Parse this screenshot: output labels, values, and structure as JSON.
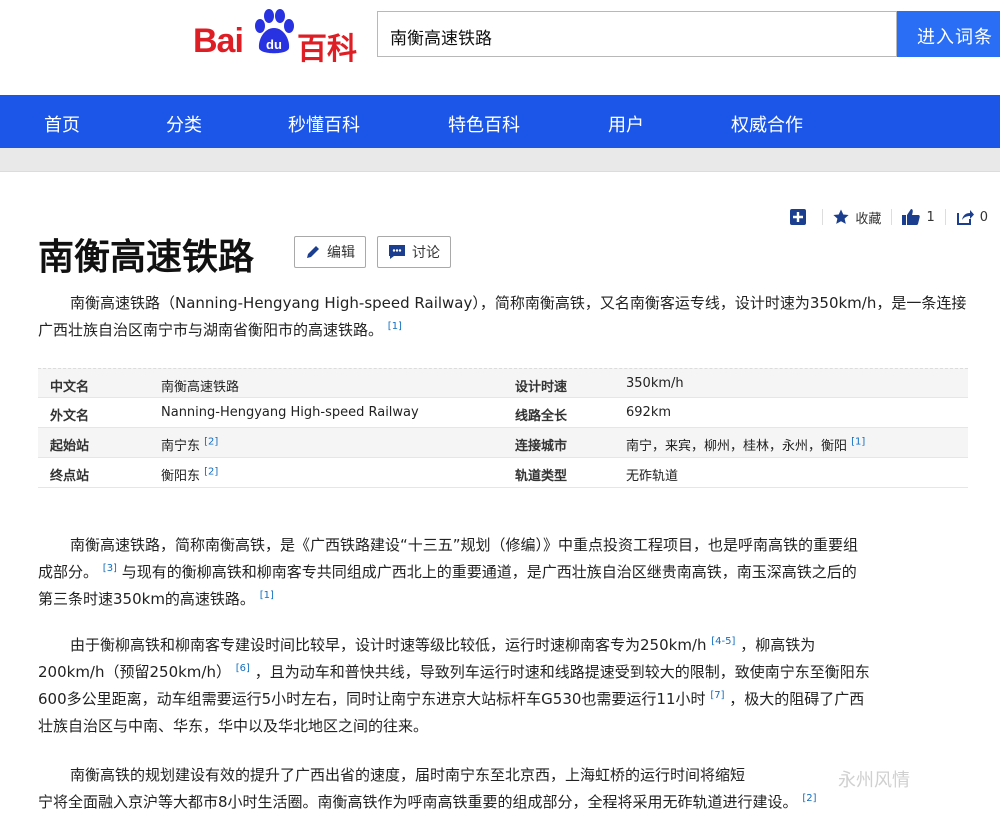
{
  "header": {
    "logo_bai": "Bai",
    "logo_du": "du",
    "logo_bk": "百科",
    "search_value": "南衡高速铁路",
    "search_button": "进入词条"
  },
  "nav": [
    "首页",
    "分类",
    "秒懂百科",
    "特色百科",
    "用户",
    "权威合作"
  ],
  "toolbar": {
    "collect_label": "收藏",
    "like_count": "1",
    "share_count": "0"
  },
  "page": {
    "title": "南衡高速铁路",
    "edit_label": "编辑",
    "discuss_label": "讨论"
  },
  "intro": {
    "text": "南衡高速铁路（Nanning-Hengyang High-speed Railway），简称南衡高铁，又名南衡客运专线，设计时速为350km/h，是一条连接广西壮族自治区南宁市与湖南省衡阳市的高速铁路。",
    "ref": "[1]"
  },
  "infobox": [
    {
      "l1": "中文名",
      "v1": "南衡高速铁路",
      "r1": "",
      "l2": "设计时速",
      "v2": "350km/h",
      "r2": ""
    },
    {
      "l1": "外文名",
      "v1": "Nanning-Hengyang High-speed Railway",
      "r1": "",
      "l2": "线路全长",
      "v2": "692km",
      "r2": ""
    },
    {
      "l1": "起始站",
      "v1": "南宁东",
      "r1": "[2]",
      "l2": "连接城市",
      "v2": "南宁，来宾，柳州，桂林，永州，衡阳",
      "r2": "[1]"
    },
    {
      "l1": "终点站",
      "v1": "衡阳东",
      "r1": "[2]",
      "l2": "轨道类型",
      "v2": "无砟轨道",
      "r2": ""
    }
  ],
  "paragraphs": [
    {
      "line1": "南衡高速铁路，简称南衡高铁，是《广西铁路建设“十三五”规划（修编）》中重点投资工程项目，也是呼南高铁的重要组",
      "line2a": "成部分。",
      "ref2a": "[3]",
      "line2b": "与现有的衡柳高铁和柳南客专共同组成广西北上的重要通道，是广西壮族自治区继贵南高铁，南玉深高铁之后的",
      "line3": "第三条时速350km的高速铁路。",
      "ref3": "[1]"
    },
    {
      "line1": "由于衡柳高铁和柳南客专建设时间比较早，设计时速等级比较低，运行时速柳南客专为250km/h",
      "ref1": "[4-5]",
      "line1b": "，柳高铁为",
      "line2": "200km/h（预留250km/h）",
      "ref2": "[6]",
      "line2b": "，且为动车和普快共线，导致列车运行时速和线路提速受到较大的限制，致使南宁东至衡阳东",
      "line3": "600多公里距离，动车组需要运行5小时左右，同时让南宁东进京大站标杆车G530也需要运行11小时",
      "ref3": "[7]",
      "line3b": "，极大的阻碍了广西",
      "line4": "壮族自治区与中南、华东，华中以及华北地区之间的往来。"
    },
    {
      "line1": "南衡高铁的规划建设有效的提升了广西出省的速度，届时南宁东至北京西，上海虹桥的运行时间将缩短",
      "line2": "宁将全面融入京沪等大都市8小时生活圈。南衡高铁作为呼南高铁重要的组成部分，全程将采用无砟轨道进行建设。",
      "ref2": "[2]"
    }
  ],
  "watermark": "永州风情",
  "colors": {
    "nav_blue": "#1b56e9",
    "search_blue": "#2a6ef5",
    "brand_red": "#de1e25",
    "paw_blue": "#2932e1",
    "ref_blue": "#136ec2"
  }
}
